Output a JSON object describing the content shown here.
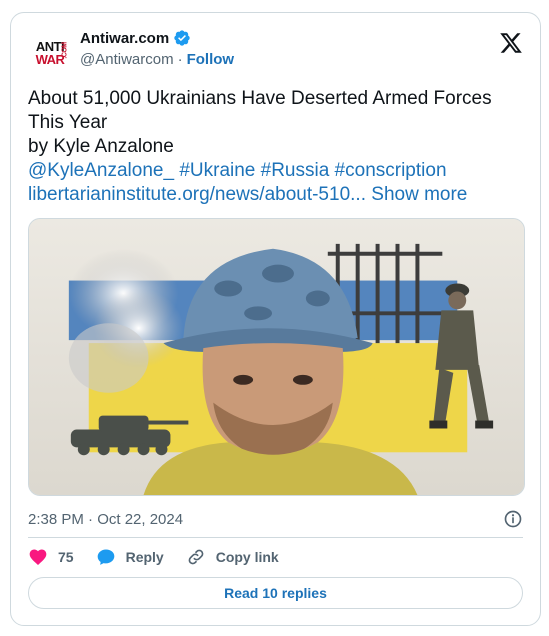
{
  "author": {
    "display_name": "Antiwar.com",
    "handle": "@Antiwarcom",
    "separator": "·",
    "follow_label": "Follow",
    "avatar_text_1": "ANTI",
    "avatar_text_2": "WAR",
    "avatar_text_3": ".COM",
    "verified_color": "#1d9bf0"
  },
  "tweet": {
    "line1": "About 51,000 Ukrainians Have Deserted Armed Forces",
    "line2": "This Year",
    "line3": "by Kyle Anzalone",
    "tags": "@KyleAnzalone_ #Ukraine #Russia #conscription",
    "url": "libertarianinstitute.org/news/about-510...",
    "show_more": "Show more"
  },
  "media": {
    "description_icon": "soldier-illustration-image"
  },
  "meta": {
    "timestamp": "2:38 PM · Oct 22, 2024"
  },
  "actions": {
    "like_count": "75",
    "reply_label": "Reply",
    "copy_link_label": "Copy link",
    "like_color": "#f91880",
    "reply_color": "#1d9bf0"
  },
  "footer": {
    "read_replies_label": "Read 10 replies"
  },
  "colors": {
    "link": "#1d72b8",
    "muted": "#536471",
    "border": "#cfd9de"
  }
}
